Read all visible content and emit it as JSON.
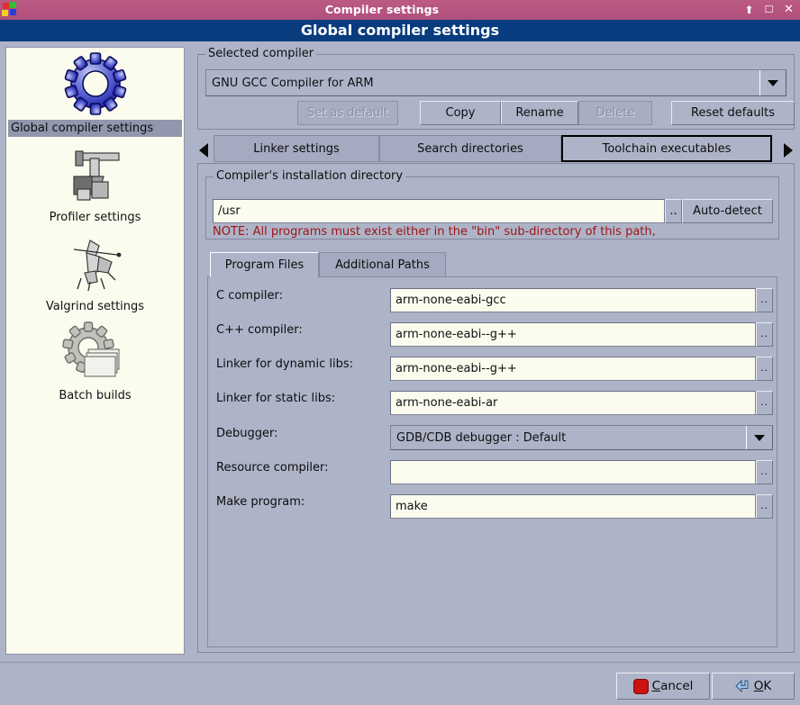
{
  "window": {
    "title": "Compiler settings",
    "logo_icon": "codeblocks-logo-icon",
    "buttons": [
      {
        "name": "shade-button",
        "glyph": "⬆"
      },
      {
        "name": "maximize-button",
        "glyph": "□"
      },
      {
        "name": "close-button",
        "glyph": "✕"
      }
    ]
  },
  "header": {
    "title": "Global compiler settings"
  },
  "sidebar": {
    "items": [
      {
        "label": "Global compiler settings",
        "icon": "blue-gear-icon",
        "selected": true
      },
      {
        "label": "Profiler settings",
        "icon": "caliper-icon",
        "selected": false
      },
      {
        "label": "Valgrind settings",
        "icon": "valgrind-icon",
        "selected": false
      },
      {
        "label": "Batch builds",
        "icon": "grey-gear-stack-icon",
        "selected": false
      }
    ]
  },
  "selected_compiler": {
    "group_title": "Selected compiler",
    "combo_value": "GNU GCC Compiler for ARM",
    "buttons": [
      {
        "label": "Set as default",
        "disabled": true
      },
      {
        "label": "Copy",
        "disabled": false
      },
      {
        "label": "Rename",
        "disabled": false
      },
      {
        "label": "Delete",
        "disabled": true
      },
      {
        "label": "Reset defaults",
        "disabled": false
      }
    ]
  },
  "tabs": {
    "scroll_left_icon": "chevron-left-icon",
    "scroll_right_icon": "chevron-right-icon",
    "items": [
      {
        "label": "Linker settings",
        "active": false
      },
      {
        "label": "Search directories",
        "active": false
      },
      {
        "label": "Toolchain executables",
        "active": true
      }
    ]
  },
  "install_dir": {
    "group_title": "Compiler's installation directory",
    "path_value": "/usr",
    "browse_label": "..",
    "autodetect_label": "Auto-detect",
    "note": "NOTE: All programs must exist either in the \"bin\" sub-directory of this path,"
  },
  "inner_tabs": [
    {
      "label": "Program Files",
      "active": true
    },
    {
      "label": "Additional Paths",
      "active": false
    }
  ],
  "program_files": {
    "browse_label": "..",
    "fields": [
      {
        "label": "C compiler:",
        "value": "arm-none-eabi-gcc",
        "type": "text"
      },
      {
        "label": "C++ compiler:",
        "value": "arm-none-eabi--g++",
        "type": "text"
      },
      {
        "label": "Linker for dynamic libs:",
        "value": "arm-none-eabi--g++",
        "type": "text"
      },
      {
        "label": "Linker for static libs:",
        "value": "arm-none-eabi-ar",
        "type": "text"
      },
      {
        "label": "Debugger:",
        "value": "GDB/CDB debugger : Default",
        "type": "combo"
      },
      {
        "label": "Resource compiler:",
        "value": "",
        "type": "text"
      },
      {
        "label": "Make program:",
        "value": "make",
        "type": "text"
      }
    ]
  },
  "footer": {
    "cancel": {
      "prefix": "",
      "accel": "C",
      "suffix": "ancel",
      "icon": "stop-icon"
    },
    "ok": {
      "prefix": "",
      "accel": "O",
      "suffix": "K",
      "icon": "enter-arrow-icon"
    }
  },
  "colors": {
    "titlebar": "#b5517f",
    "header": "#083c7e",
    "window_bg": "#aeb4c8",
    "sidebar_bg": "#fbfbee",
    "field_bg": "#fbfbee",
    "note_red": "#9e1414",
    "selection": "#9197ad"
  }
}
